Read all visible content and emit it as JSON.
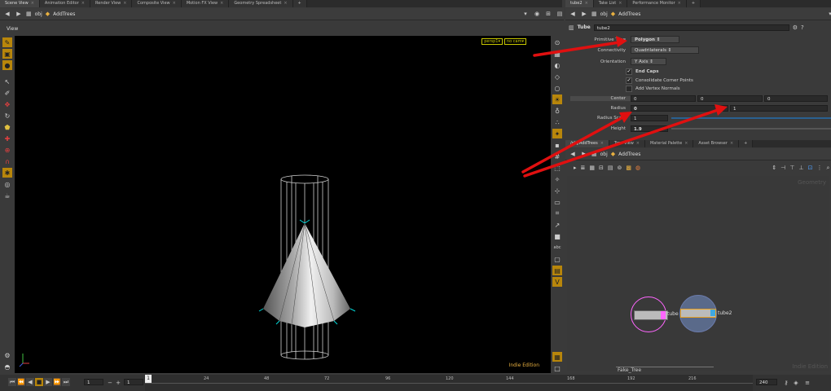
{
  "left_tabs": [
    "Scene View",
    "Animation Editor",
    "Render View",
    "Composite View",
    "Motion FX View",
    "Geometry Spreadsheet"
  ],
  "right_top_tabs": [
    "tube2",
    "Take List",
    "Performance Monitor"
  ],
  "right_bottom_tabs": [
    "/obj/AddTrees",
    "Tree View",
    "Material Palette",
    "Asset Browser"
  ],
  "path": {
    "context": "obj",
    "node": "AddTrees"
  },
  "viewport": {
    "title": "View",
    "camera_persp": "persp1",
    "camera_nocam": "no cam",
    "watermark": "Indie Edition"
  },
  "parms": {
    "node_type": "Tube",
    "node_name": "tube2",
    "primitive_type": {
      "label": "Primitive Type",
      "value": "Polygon"
    },
    "connectivity": {
      "label": "Connectivity",
      "value": "Quadrilaterals"
    },
    "orientation": {
      "label": "Orientation",
      "value": "Y Axis"
    },
    "end_caps": {
      "label": "End Caps",
      "checked": true
    },
    "consolidate": {
      "label": "Consolidate Corner Points",
      "checked": true
    },
    "add_vertex_normals": {
      "label": "Add Vertex Normals",
      "checked": false
    },
    "center": {
      "label": "Center",
      "values": [
        "0",
        "0",
        "0"
      ]
    },
    "radius": {
      "label": "Radius",
      "values": [
        "0",
        "1"
      ]
    },
    "radius_scale": {
      "label": "Radius Scale",
      "value": "1"
    },
    "height": {
      "label": "Height",
      "value": "1.9"
    }
  },
  "network": {
    "context_label": "Geometry",
    "watermark": "Indie Edition",
    "nodes": [
      {
        "name": "tube"
      },
      {
        "name": "tube2"
      }
    ],
    "footer_label": "Fake_Tree"
  },
  "timeline": {
    "current_frame": "1",
    "start_frame": "1",
    "frame_marker": "1",
    "end_frame": "240",
    "ticks": [
      "24",
      "48",
      "72",
      "96",
      "120",
      "144",
      "168",
      "192",
      "216"
    ]
  },
  "colors": {
    "arrow": "#e01010",
    "highlight": "#b8860b",
    "node_select": "#ff66ff",
    "node_display": "#3fa8e0"
  }
}
